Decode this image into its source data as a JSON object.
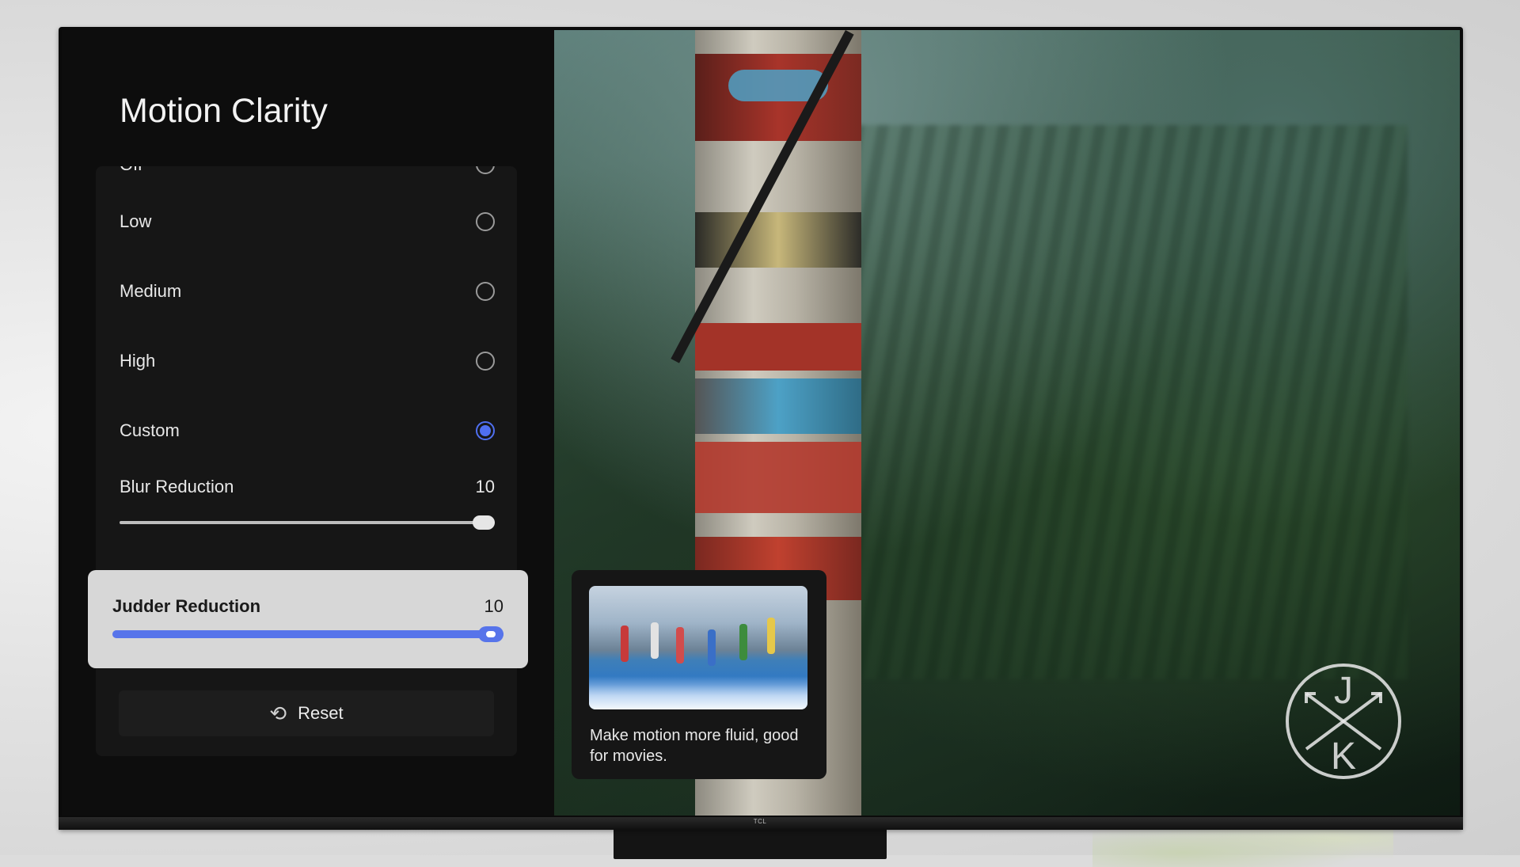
{
  "panel": {
    "title": "Motion Clarity",
    "options": [
      {
        "label": "Off",
        "selected": false
      },
      {
        "label": "Low",
        "selected": false
      },
      {
        "label": "Medium",
        "selected": false
      },
      {
        "label": "High",
        "selected": false
      },
      {
        "label": "Custom",
        "selected": true
      }
    ],
    "blur_reduction": {
      "label": "Blur Reduction",
      "value": "10",
      "level_fraction": 1.0
    },
    "judder_reduction": {
      "label": "Judder Reduction",
      "value": "10",
      "level_fraction": 1.0
    },
    "reset_label": "Reset"
  },
  "info": {
    "description": "Make motion more fluid, good for movies."
  },
  "watermark": {
    "top": "J",
    "bottom": "K"
  },
  "tv": {
    "brand": "TCL"
  },
  "colors": {
    "accent": "#5774ea",
    "focus_bg": "#d7d7d7",
    "panel_bg": "#0d0d0d"
  }
}
